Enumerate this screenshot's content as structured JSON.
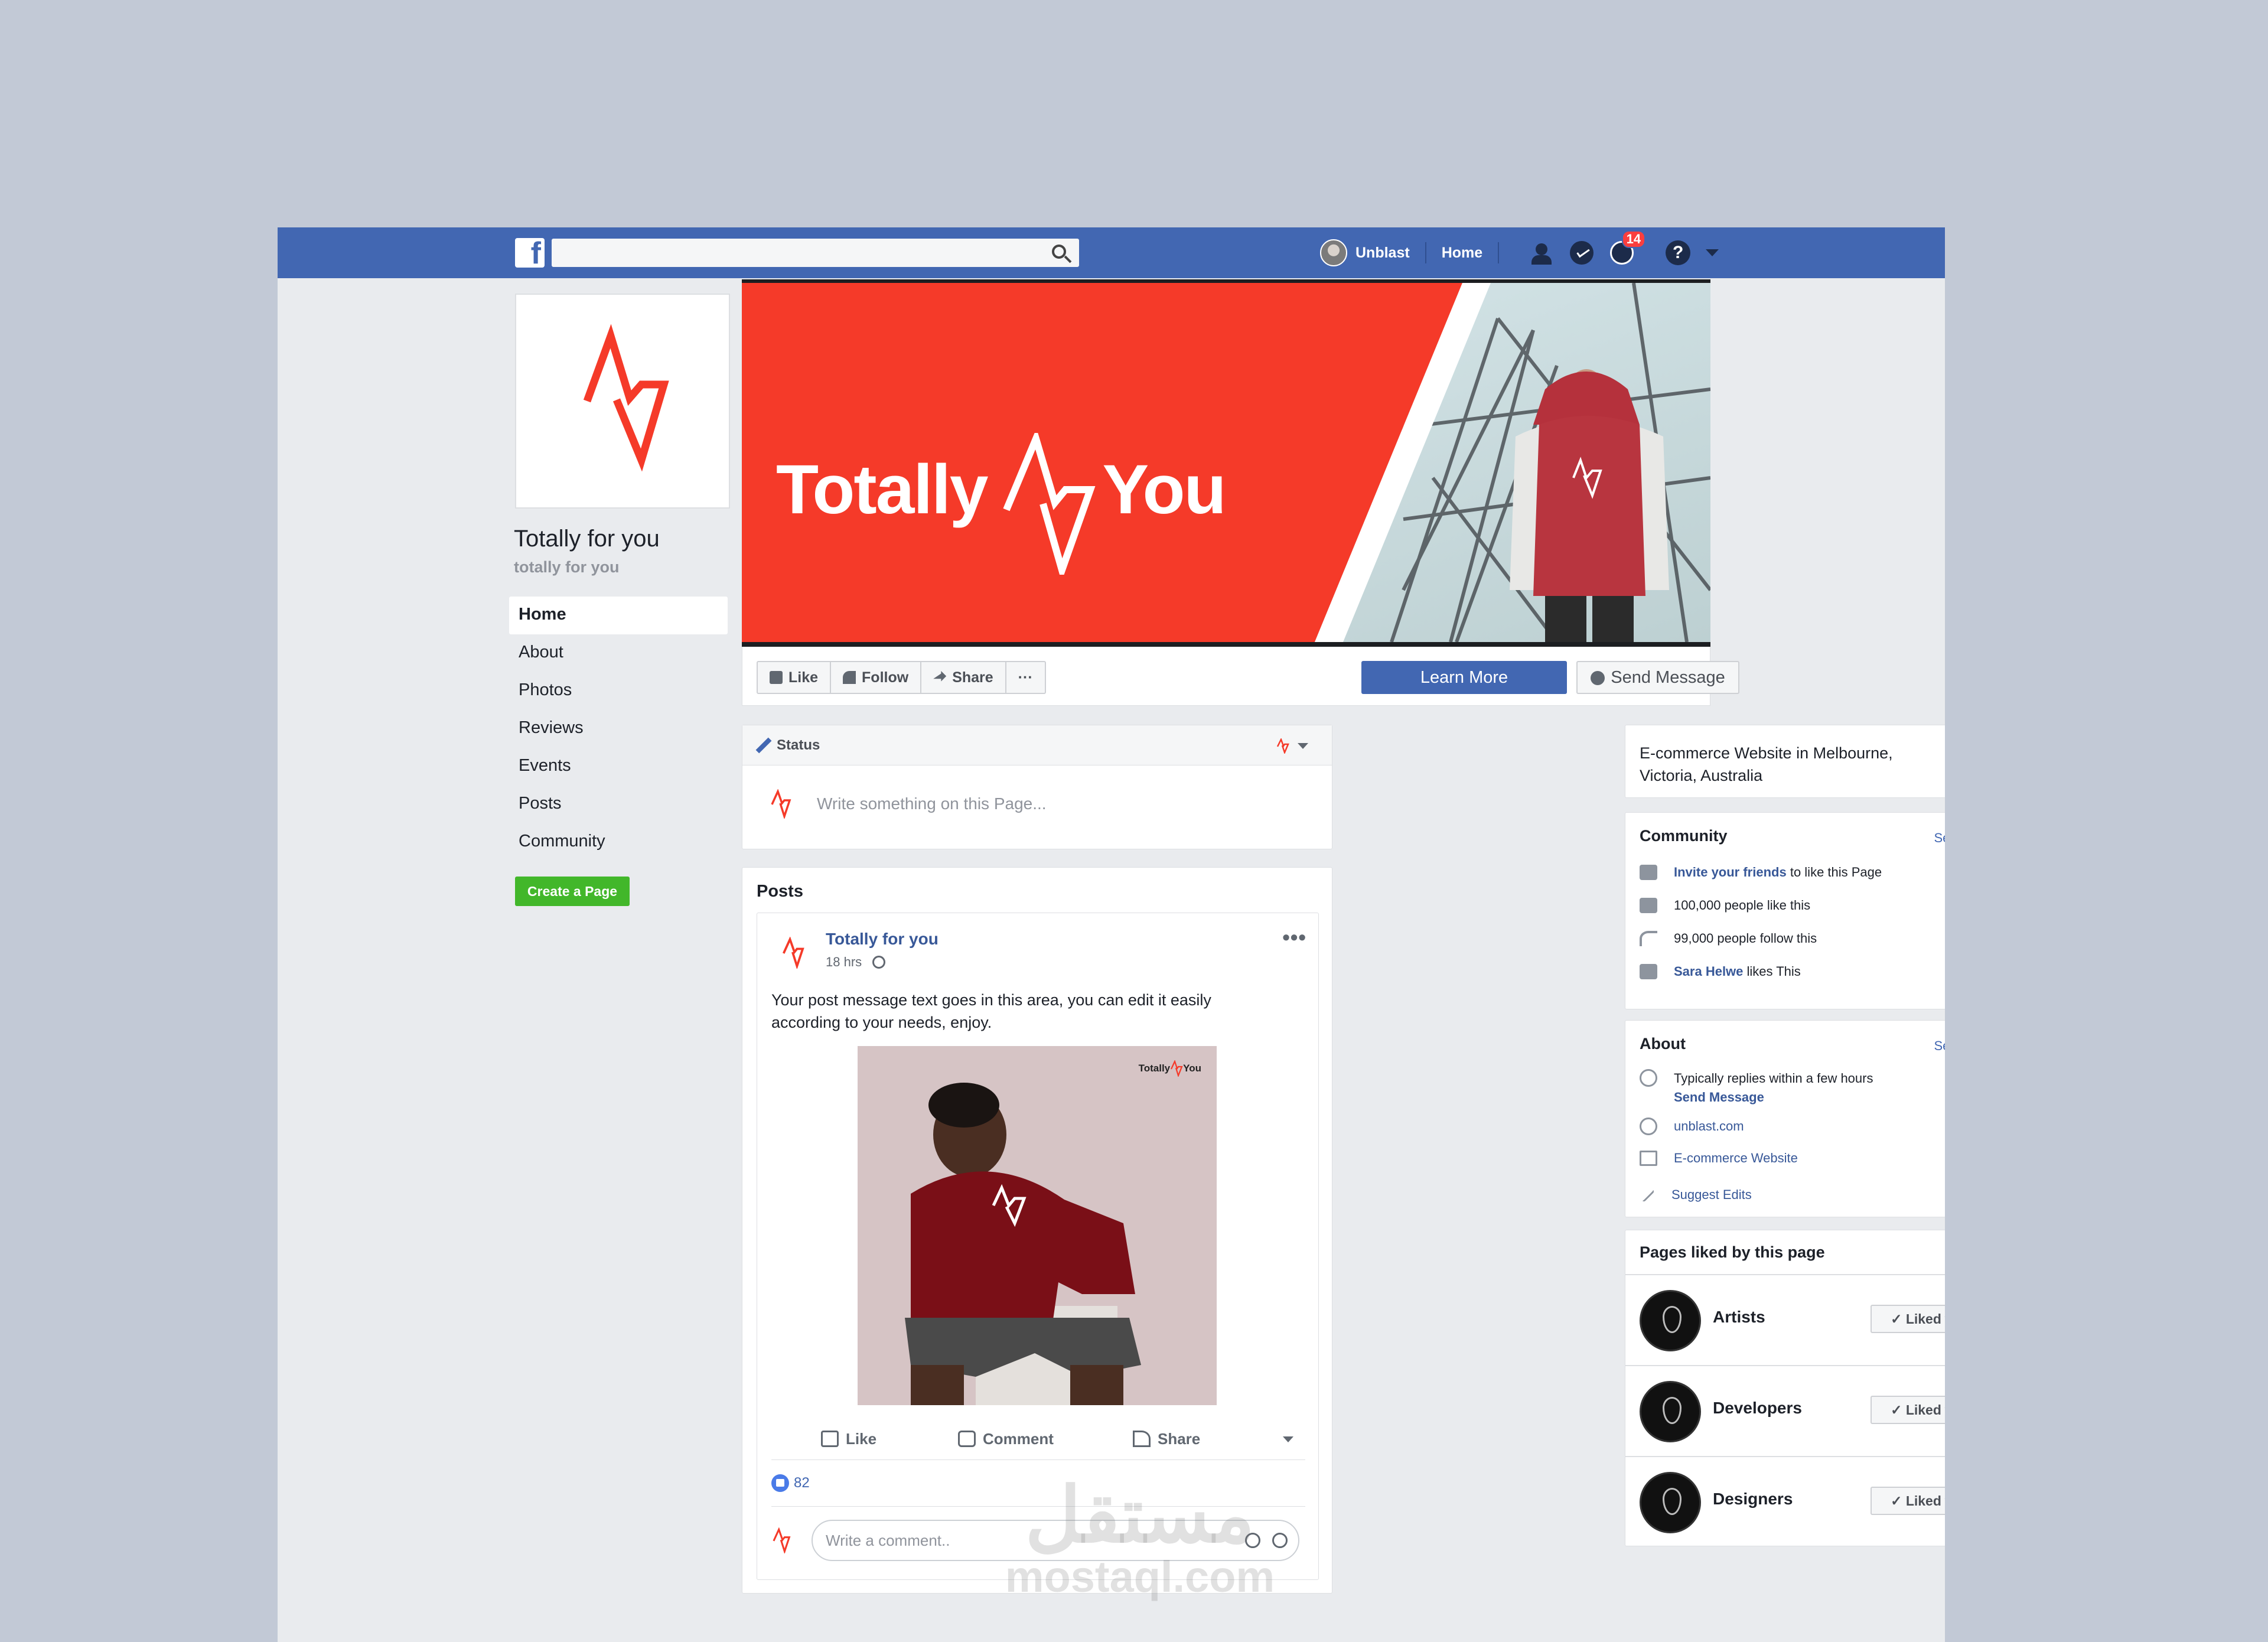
{
  "topbar": {
    "logo_letter": "f",
    "search_placeholder": "",
    "user_name": "Unblast",
    "home_label": "Home",
    "notifications_count": "14",
    "help_label": "?"
  },
  "sidebar": {
    "page_name": "Totally for you",
    "page_handle": "totally for you",
    "items": [
      {
        "label": "Home"
      },
      {
        "label": "About"
      },
      {
        "label": "Photos"
      },
      {
        "label": "Reviews"
      },
      {
        "label": "Events"
      },
      {
        "label": "Posts"
      },
      {
        "label": "Community"
      }
    ],
    "create_page_label": "Create a Page"
  },
  "cover": {
    "title_left": "Totally",
    "title_right": "You",
    "brand_color": "#f53a29"
  },
  "actions": {
    "like": "Like",
    "follow": "Follow",
    "share": "Share",
    "more": "···",
    "learn_more": "Learn More",
    "send_message": "Send Message"
  },
  "status": {
    "label": "Status",
    "placeholder": "Write something on this Page..."
  },
  "posts": {
    "title": "Posts",
    "post": {
      "author": "Totally for you",
      "time": "18 hrs",
      "text": "Your post message text goes in this area, you can edit it easily according to your needs, enjoy.",
      "image_brand_left": "Totally",
      "image_brand_right": "You",
      "like": "Like",
      "comment": "Comment",
      "share": "Share",
      "likes_count": "82",
      "comment_placeholder": "Write a comment.."
    }
  },
  "right": {
    "category": "E-commerce Website in Melbourne, Victoria, Australia",
    "community": {
      "title": "Community",
      "see_all": "See All",
      "invite_link": "Invite your friends",
      "invite_rest": " to like this Page",
      "likes": "100,000 people like this",
      "follows": "99,000 people follow this",
      "friend_name": "Sara Helwe",
      "friend_rest": " likes This"
    },
    "about": {
      "title": "About",
      "see_all": "See All",
      "replies": "Typically replies within a few hours",
      "send_message": "Send Message",
      "website": "unblast.com",
      "category": "E-commerce Website",
      "suggest": "Suggest Edits"
    },
    "pages_liked": {
      "title": "Pages liked by this page",
      "liked_label": "Liked",
      "pages": [
        {
          "name": "Artists"
        },
        {
          "name": "Developers"
        },
        {
          "name": "Designers"
        }
      ]
    }
  },
  "watermark": {
    "arabic": "مستقل",
    "latin": "mostaql.com"
  }
}
